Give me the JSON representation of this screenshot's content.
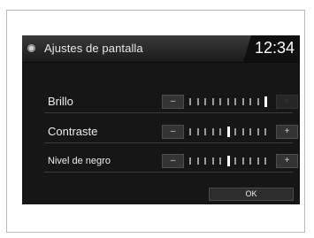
{
  "header": {
    "title": "Ajustes de pantalla",
    "clock": "12:34",
    "icon": "settings-disc-icon"
  },
  "settings": [
    {
      "label": "Brillo",
      "minus": "–",
      "plus": "+",
      "level": 1.0,
      "steps": 11,
      "plus_enabled": false
    },
    {
      "label": "Contraste",
      "minus": "–",
      "plus": "+",
      "level": 0.5,
      "steps": 11,
      "plus_enabled": true
    },
    {
      "label": "Nivel de negro",
      "minus": "–",
      "plus": "+",
      "level": 0.5,
      "steps": 11,
      "plus_enabled": true
    }
  ],
  "footer": {
    "ok_label": "OK"
  }
}
